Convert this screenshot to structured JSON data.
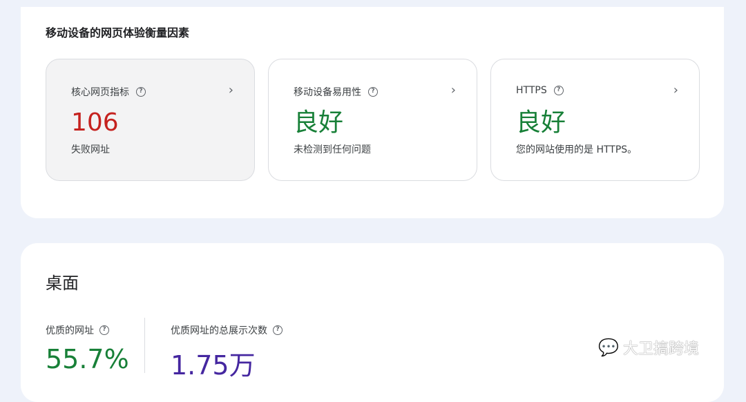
{
  "mobile_section": {
    "title": "移动设备的网页体验衡量因素",
    "tiles": [
      {
        "label": "核心网页指标",
        "value": "106",
        "sub": "失败网址"
      },
      {
        "label": "移动设备易用性",
        "value": "良好",
        "sub": "未检测到任何问题"
      },
      {
        "label": "HTTPS",
        "value": "良好",
        "sub": "您的网站使用的是 HTTPS。"
      }
    ]
  },
  "desktop_section": {
    "title": "桌面",
    "metrics": [
      {
        "label": "优质的网址",
        "value": "55.7%"
      },
      {
        "label": "优质网址的总展示次数",
        "value": "1.75万"
      }
    ]
  },
  "watermark": "大卫搞跨境",
  "icons": {
    "help": "?",
    "chevron": "›"
  },
  "colors": {
    "fail": "#c5221f",
    "good": "#188038",
    "impressions": "#4527a0"
  }
}
